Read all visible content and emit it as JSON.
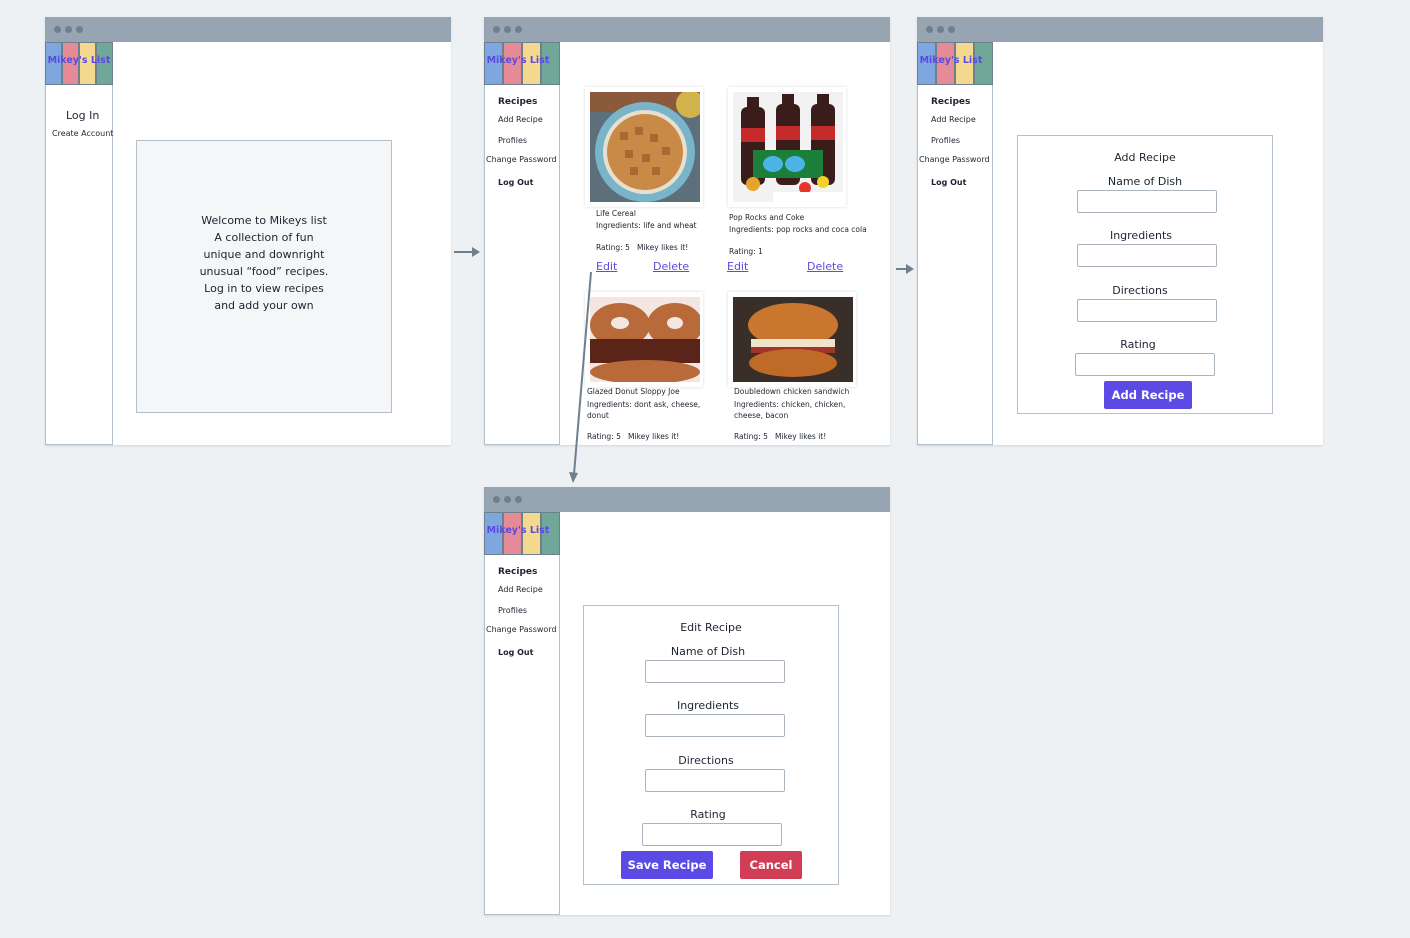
{
  "logo": {
    "text": "Mikey's List",
    "colors": [
      "#7ea6df",
      "#e58a97",
      "#f4d88e",
      "#6fa898"
    ]
  },
  "login_window": {
    "nav": {
      "login": "Log In",
      "create_account": "Create Account"
    },
    "welcome_lines": [
      "Welcome to Mikeys list",
      "A collection of fun",
      "unique and downright",
      "unusual “food” recipes.",
      "Log in to view recipes",
      "and add your own"
    ]
  },
  "nav": {
    "recipes": "Recipes",
    "add_recipe": "Add Recipe",
    "profiles": "Profiles",
    "change_password": "Change Password",
    "log_out": "Log Out"
  },
  "recipes": [
    {
      "name": "Life Cereal",
      "ingredients": "Ingredients: life and wheat",
      "rating": "Rating: 5",
      "likes": "Mikey likes it!",
      "image": "cereal-bowl"
    },
    {
      "name": "Pop Rocks and Coke",
      "ingredients": "Ingredients: pop rocks and coca cola",
      "rating": "Rating: 1",
      "likes": "",
      "image": "pop-rocks-coke"
    },
    {
      "name": "Glazed Donut Sloppy Joe",
      "ingredients": "Ingredients: dont ask, cheese, donut",
      "rating": "Rating: 5",
      "likes": "Mikey likes it!",
      "image": "donut-burger"
    },
    {
      "name": "Doubledown chicken sandwich",
      "ingredients": "Ingredients: chicken, chicken, cheese, bacon",
      "rating": "Rating: 5",
      "likes": "Mikey likes it!",
      "image": "chicken-sandwich"
    }
  ],
  "actions": {
    "edit": "Edit",
    "delete": "Delete"
  },
  "add_form": {
    "title": "Add Recipe",
    "name_label": "Name of Dish",
    "ingredients_label": "Ingredients",
    "directions_label": "Directions",
    "rating_label": "Rating",
    "submit": "Add Recipe"
  },
  "edit_form": {
    "title": "Edit Recipe",
    "name_label": "Name of Dish",
    "ingredients_label": "Ingredients",
    "directions_label": "Directions",
    "rating_label": "Rating",
    "save": "Save Recipe",
    "cancel": "Cancel"
  },
  "colors": {
    "primary": "#5b4be4",
    "danger": "#d13d55",
    "titlebar": "#97a5b3",
    "background": "#eef1f4"
  }
}
